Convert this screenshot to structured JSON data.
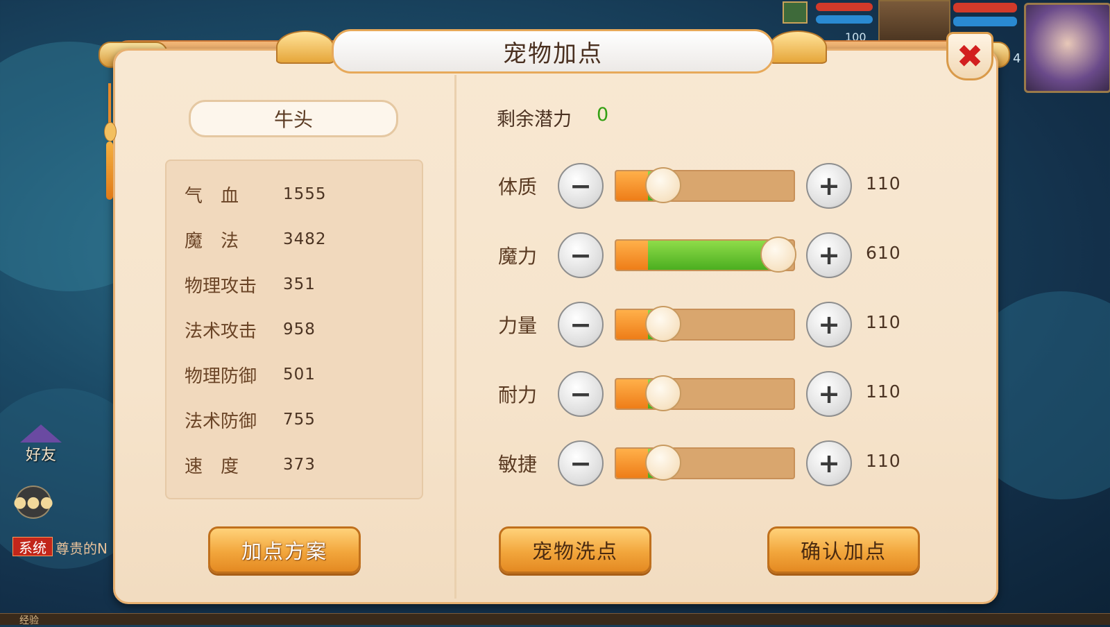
{
  "dialog": {
    "title": "宠物加点",
    "close_icon": "close-x-icon"
  },
  "pet": {
    "name": "牛头",
    "stats": [
      {
        "label": "气　血",
        "value": "1555"
      },
      {
        "label": "魔　法",
        "value": "3482"
      },
      {
        "label": "物理攻击",
        "value": "351"
      },
      {
        "label": "法术攻击",
        "value": "958"
      },
      {
        "label": "物理防御",
        "value": "501"
      },
      {
        "label": "法术防御",
        "value": "755"
      },
      {
        "label": "速　度",
        "value": "373"
      }
    ]
  },
  "potential": {
    "label": "剩余潜力",
    "value": "0"
  },
  "attributes": [
    {
      "label": "体质",
      "value": "110",
      "level": 0.2
    },
    {
      "label": "魔力",
      "value": "610",
      "level": 1.0
    },
    {
      "label": "力量",
      "value": "110",
      "level": 0.2
    },
    {
      "label": "耐力",
      "value": "110",
      "level": 0.2
    },
    {
      "label": "敏捷",
      "value": "110",
      "level": 0.2
    }
  ],
  "buttons": {
    "plan": "加点方案",
    "reset": "宠物洗点",
    "confirm": "确认加点"
  },
  "side": {
    "friends": "好友",
    "system_tag": "系统",
    "system_msg": "尊贵的N",
    "exp": "经验"
  },
  "hud": {
    "pet_level": "100",
    "player_level": "4"
  },
  "colors": {
    "accent_orange": "#ee7d18",
    "accent_green": "#4bae20",
    "potential_green": "#34a014",
    "close_red": "#d21f1f"
  }
}
